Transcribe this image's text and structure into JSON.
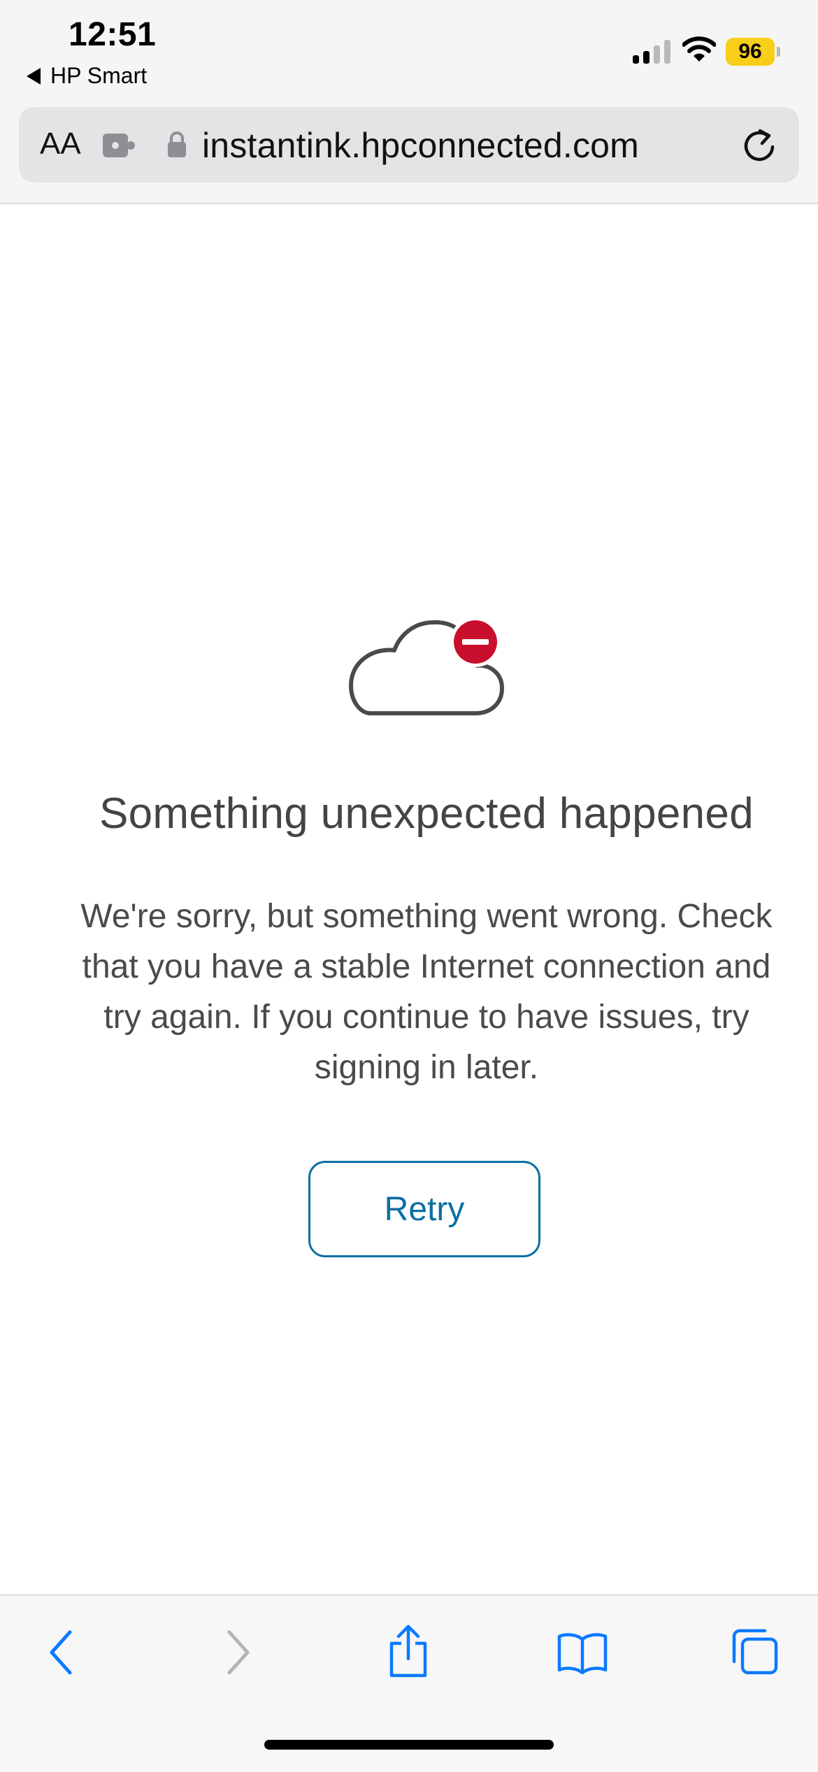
{
  "status_bar": {
    "time": "12:51",
    "back_app_label": "HP Smart",
    "battery_level": "96",
    "battery_color": "#f7ce1a",
    "signal_bars_active": 2,
    "signal_bars_total": 4
  },
  "address_bar": {
    "text_size_label": "AA",
    "url": "instantink.hpconnected.com",
    "icons": [
      "extension-icon",
      "lock-icon",
      "reload-icon"
    ]
  },
  "main": {
    "icon": "cloud-error-icon",
    "title": "Something unexpected happened",
    "message": "We're sorry, but something went wrong. Check that you have a stable Internet connection and try again. If you continue to have issues, try signing in later.",
    "retry_label": "Retry"
  },
  "toolbar": {
    "items": [
      "back-icon",
      "forward-icon",
      "share-icon",
      "bookmarks-icon",
      "tabs-icon"
    ]
  },
  "colors": {
    "accent": "#0a6fa3",
    "error_red": "#c8102e",
    "safari_blue": "#0a7aff",
    "text": "#444444"
  }
}
